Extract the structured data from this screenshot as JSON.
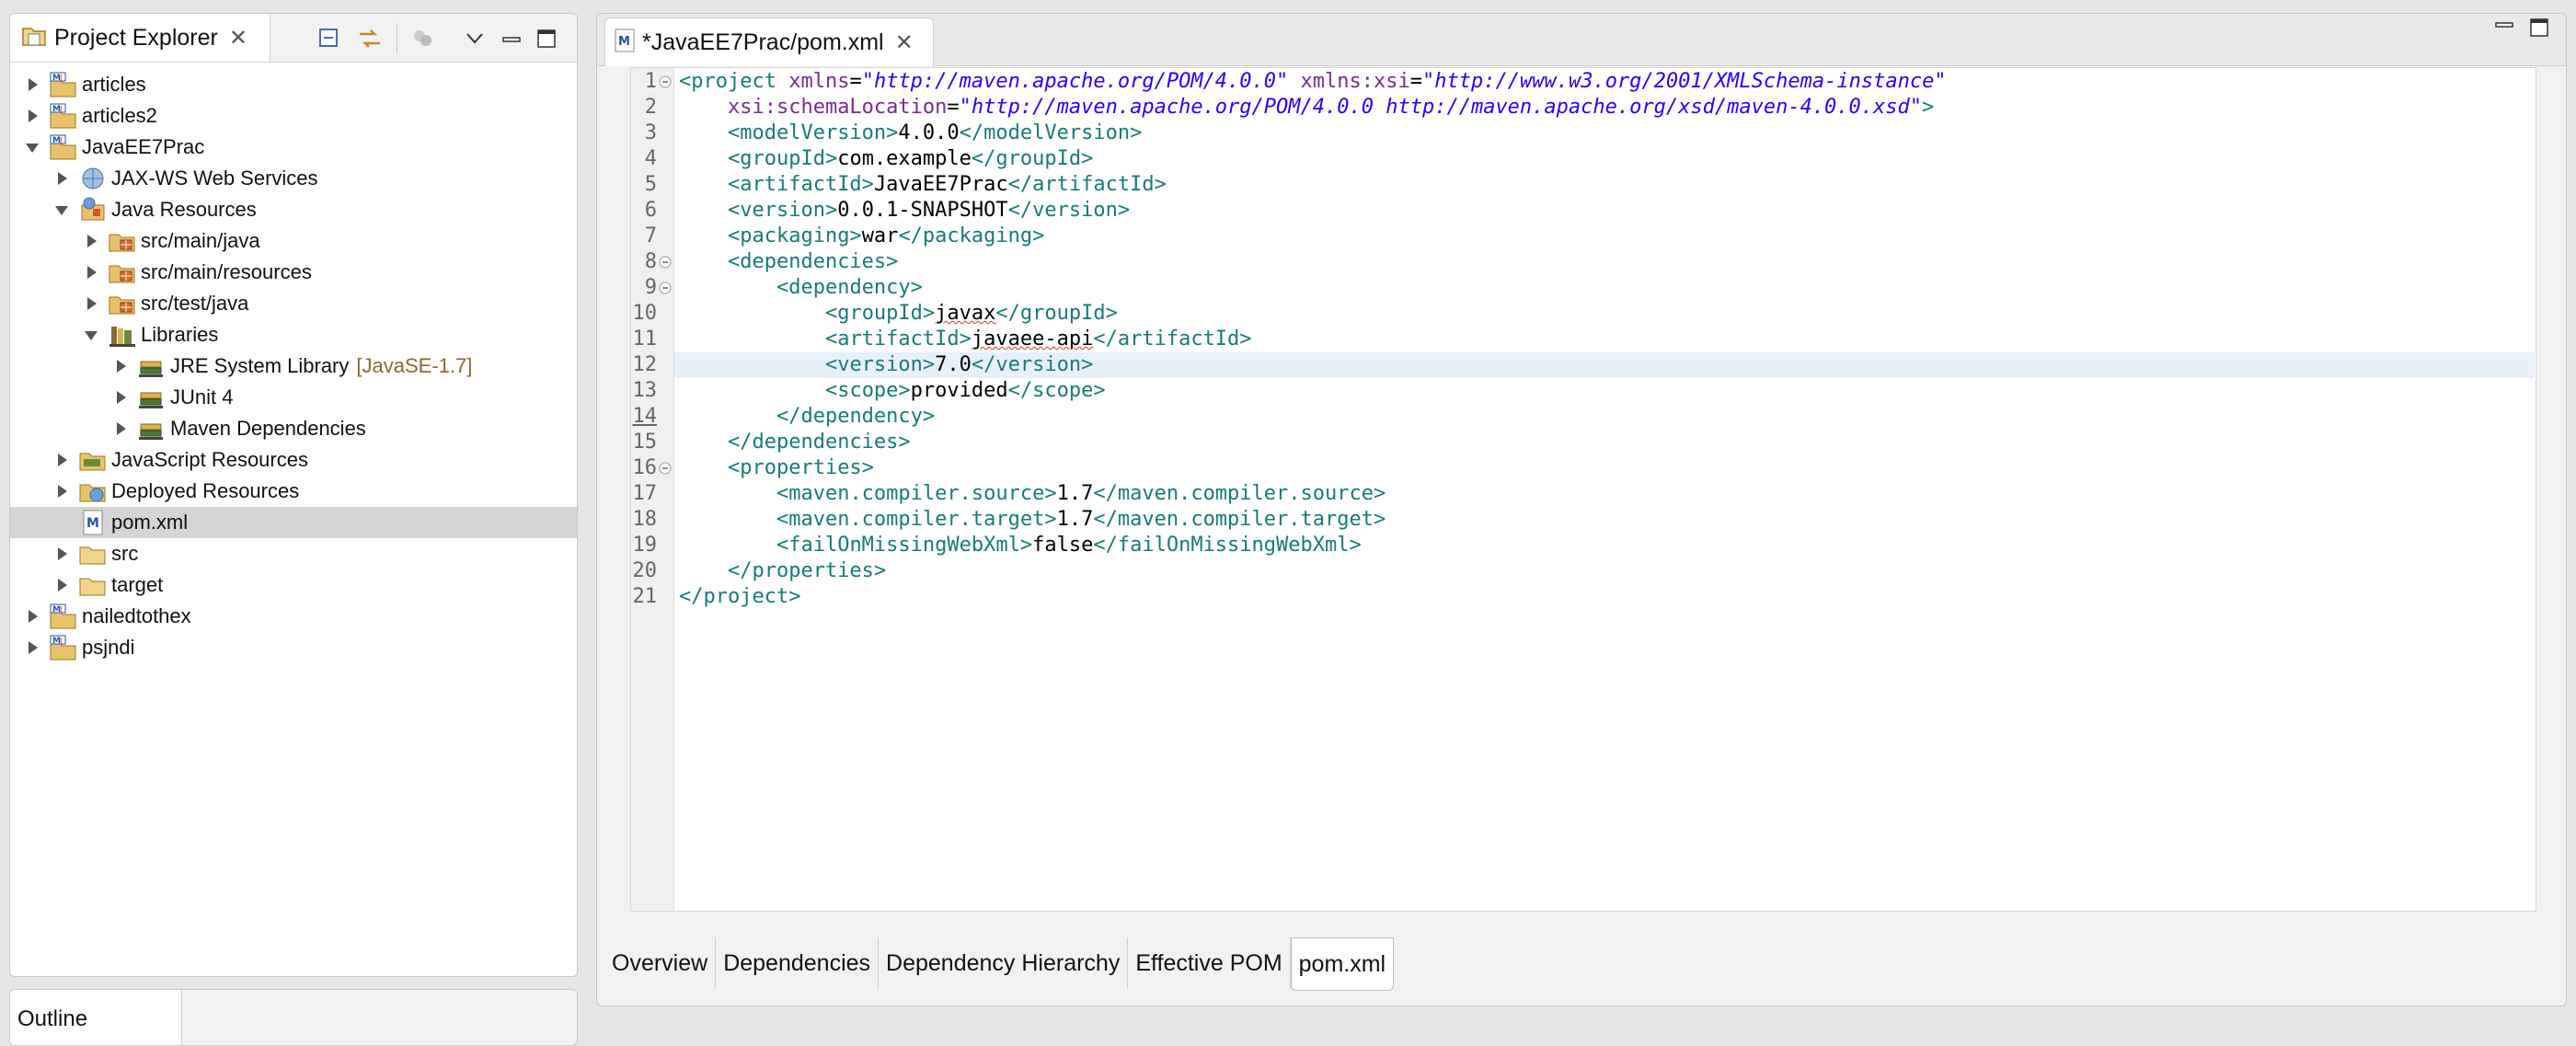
{
  "project_explorer": {
    "title": "Project Explorer",
    "tree": [
      {
        "label": "articles",
        "icon": "maven-project-icon",
        "expanded": false
      },
      {
        "label": "articles2",
        "icon": "maven-project-icon",
        "expanded": false
      },
      {
        "label": "JavaEE7Prac",
        "icon": "maven-project-icon",
        "expanded": true
      },
      {
        "label": "JAX-WS Web Services",
        "icon": "web-services-icon",
        "expanded": false
      },
      {
        "label": "Java Resources",
        "icon": "java-resources-icon",
        "expanded": true
      },
      {
        "label": "src/main/java",
        "icon": "source-folder-icon",
        "expanded": false
      },
      {
        "label": "src/main/resources",
        "icon": "source-folder-icon",
        "expanded": false
      },
      {
        "label": "src/test/java",
        "icon": "source-folder-icon",
        "expanded": false
      },
      {
        "label": "Libraries",
        "icon": "libraries-icon",
        "expanded": true
      },
      {
        "label": "JRE System Library",
        "decoration": "[JavaSE-1.7]",
        "icon": "library-icon",
        "expanded": false
      },
      {
        "label": "JUnit 4",
        "icon": "library-icon",
        "expanded": false
      },
      {
        "label": "Maven Dependencies",
        "icon": "library-icon",
        "expanded": false
      },
      {
        "label": "JavaScript Resources",
        "icon": "javascript-resources-icon",
        "expanded": false
      },
      {
        "label": "Deployed Resources",
        "icon": "deployed-resources-icon",
        "expanded": false
      },
      {
        "label": "pom.xml",
        "icon": "maven-file-icon",
        "selected": true
      },
      {
        "label": "src",
        "icon": "folder-icon",
        "expanded": false
      },
      {
        "label": "target",
        "icon": "folder-icon",
        "expanded": false
      },
      {
        "label": "nailedtothex",
        "icon": "maven-project-icon",
        "expanded": false
      },
      {
        "label": "psjndi",
        "icon": "maven-project-icon",
        "expanded": false
      }
    ]
  },
  "outline": {
    "title": "Outline"
  },
  "editor": {
    "tab_title": "*JavaEE7Prac/pom.xml",
    "current_line": 14,
    "lines": [
      "1",
      "2",
      "3",
      "4",
      "5",
      "6",
      "7",
      "8",
      "9",
      "10",
      "11",
      "12",
      "13",
      "14",
      "15",
      "16",
      "17",
      "18",
      "19",
      "20",
      "21"
    ],
    "code": {
      "l1_tag_open": "<project ",
      "l1_attr1": "xmlns",
      "l1_val1": "\"http://maven.apache.org/POM/4.0.0\"",
      "l1_attr2": "xmlns:xsi",
      "l1_val2": "\"http://www.w3.org/2001/XMLSchema-instance\"",
      "l2_attr": "xsi:schemaLocation",
      "l2_val": "\"http://maven.apache.org/POM/4.0.0 http://maven.apache.org/xsd/maven-4.0.0.xsd\"",
      "l2_close": ">",
      "modelVersion": "4.0.0",
      "groupId": "com.example",
      "artifactId": "JavaEE7Prac",
      "version": "0.0.1-SNAPSHOT",
      "packaging": "war",
      "dep_groupId": "javax",
      "dep_artifactId": "javaee-api",
      "dep_version": "7.0",
      "dep_scope": "provided",
      "compiler_source": "1.7",
      "compiler_target": "1.7",
      "failOnMissingWebXml": "false"
    },
    "bottom_tabs": [
      "Overview",
      "Dependencies",
      "Dependency Hierarchy",
      "Effective POM",
      "pom.xml"
    ],
    "active_bottom_tab": "pom.xml"
  },
  "colors": {
    "tag": "#177b79",
    "attribute": "#7a2c92",
    "value": "#2a00ff",
    "selection": "#d4d4d4",
    "current_line": "#e8f0fa"
  }
}
